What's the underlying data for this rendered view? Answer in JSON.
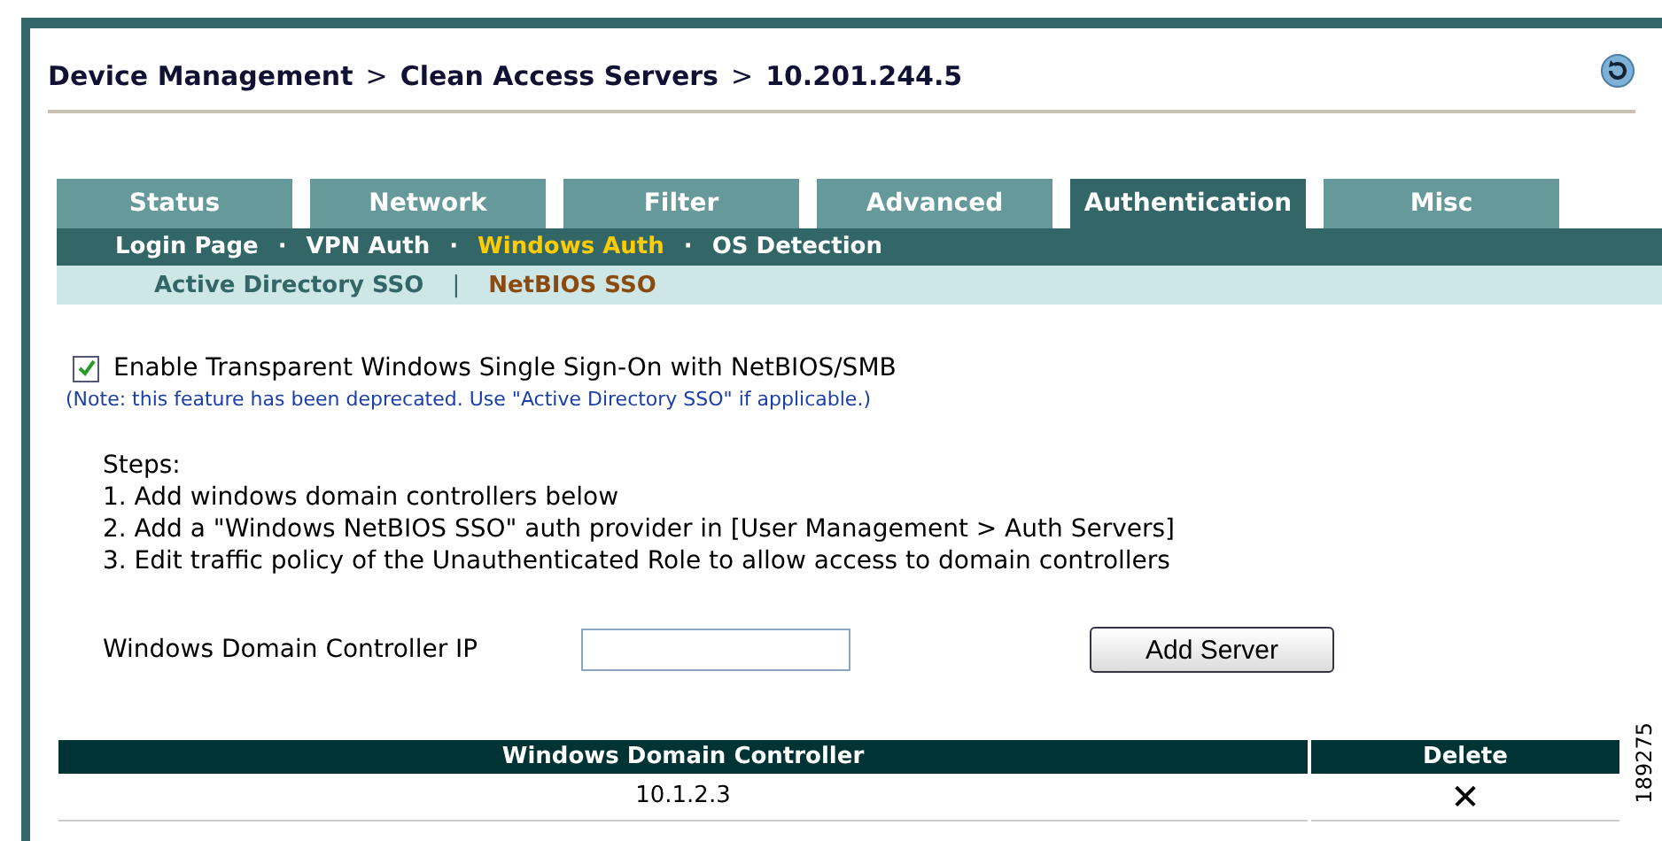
{
  "breadcrumb": [
    "Device Management",
    "Clean Access Servers",
    "10.201.244.5"
  ],
  "breadcrumb_separator": ">",
  "tabs": [
    {
      "label": "Status",
      "selected": false
    },
    {
      "label": "Network",
      "selected": false
    },
    {
      "label": "Filter",
      "selected": false
    },
    {
      "label": "Advanced",
      "selected": false
    },
    {
      "label": "Authentication",
      "selected": true
    },
    {
      "label": "Misc",
      "selected": false
    }
  ],
  "subtabs": [
    {
      "label": "Login Page",
      "selected": false
    },
    {
      "label": "VPN Auth",
      "selected": false
    },
    {
      "label": "Windows Auth",
      "selected": true
    },
    {
      "label": "OS Detection",
      "selected": false
    }
  ],
  "subtab_separator": "·",
  "subsubtabs": [
    {
      "label": "Active Directory SSO",
      "selected": false
    },
    {
      "label": "NetBIOS SSO",
      "selected": true
    }
  ],
  "subsubtab_separator": "|",
  "enable_option": {
    "label": "Enable Transparent Windows Single Sign-On with NetBIOS/SMB",
    "checked": true
  },
  "note": "(Note: this feature has been deprecated. Use \"Active Directory SSO\" if applicable.)",
  "steps": [
    "Steps:",
    "1. Add windows domain controllers below",
    "2. Add a \"Windows NetBIOS SSO\" auth provider in [User Management > Auth Servers]",
    "3. Edit traffic policy of the Unauthenticated Role to allow access to domain controllers"
  ],
  "controller_field": {
    "label": "Windows Domain Controller IP"
  },
  "add_button": "Add Server",
  "table": {
    "columns": [
      "Windows Domain Controller",
      "Delete"
    ],
    "rows": [
      {
        "controller": "10.1.2.3",
        "delete": "✕"
      }
    ]
  },
  "figure_id": "189275"
}
